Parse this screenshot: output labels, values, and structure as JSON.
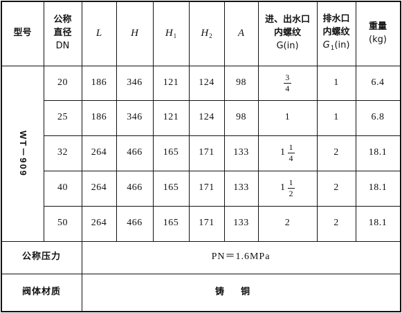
{
  "table": {
    "header": {
      "model": "型号",
      "nominal_dia": [
        "公称",
        "直径",
        "DN"
      ],
      "L": "L",
      "H": "H",
      "H1_base": "H",
      "H1_sub": "1",
      "H2_base": "H",
      "H2_sub": "2",
      "A": "A",
      "inlet": [
        "进、出水口",
        "内螺纹",
        "G(in)"
      ],
      "drain_lines": [
        "排水口",
        "内螺纹"
      ],
      "drain_G": "G",
      "drain_sub": "1",
      "drain_unit": "(in)",
      "weight": [
        "重量",
        "(kg)"
      ]
    },
    "model_value": "WT－909",
    "rows": [
      {
        "dn": "20",
        "L": "186",
        "H": "346",
        "H1": "121",
        "H2": "124",
        "A": "98",
        "G_whole": "",
        "G_num": "3",
        "G_den": "4",
        "G_text": "",
        "G1": "1",
        "weight": "6.4"
      },
      {
        "dn": "25",
        "L": "186",
        "H": "346",
        "H1": "121",
        "H2": "124",
        "A": "98",
        "G_whole": "",
        "G_num": "",
        "G_den": "",
        "G_text": "1",
        "G1": "1",
        "weight": "6.8"
      },
      {
        "dn": "32",
        "L": "264",
        "H": "466",
        "H1": "165",
        "H2": "171",
        "A": "133",
        "G_whole": "1",
        "G_num": "1",
        "G_den": "4",
        "G_text": "",
        "G1": "2",
        "weight": "18.1"
      },
      {
        "dn": "40",
        "L": "264",
        "H": "466",
        "H1": "165",
        "H2": "171",
        "A": "133",
        "G_whole": "1",
        "G_num": "1",
        "G_den": "2",
        "G_text": "",
        "G1": "2",
        "weight": "18.1"
      },
      {
        "dn": "50",
        "L": "264",
        "H": "466",
        "H1": "165",
        "H2": "171",
        "A": "133",
        "G_whole": "",
        "G_num": "",
        "G_den": "",
        "G_text": "2",
        "G1": "2",
        "weight": "18.1"
      }
    ],
    "pressure_label": "公称压力",
    "pressure_value": "PN＝1.6MPa",
    "material_label": "阀体材质",
    "material_value": "铸铜"
  }
}
